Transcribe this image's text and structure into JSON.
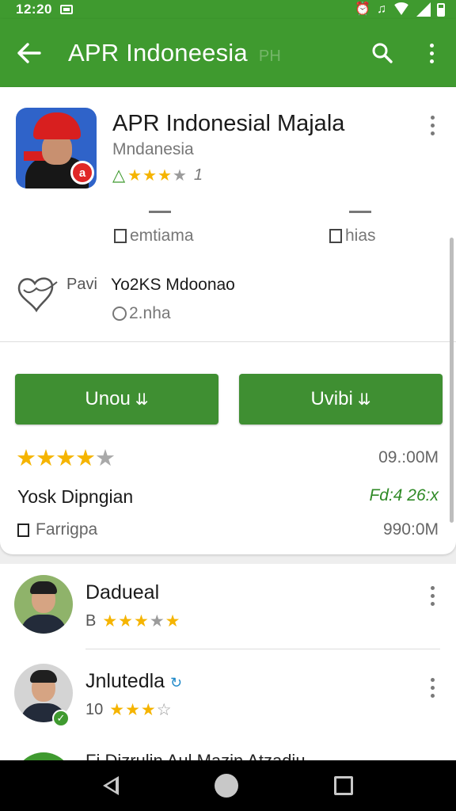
{
  "status_bar": {
    "time": "12:20"
  },
  "app_bar": {
    "title": "APR Indoneesia",
    "ghost_text": "PH"
  },
  "app": {
    "name": "APR Indonesial Majala",
    "developer": "Mndanesia",
    "rating_number": "1",
    "tags": [
      {
        "label": "emtiama"
      },
      {
        "label": "hias"
      }
    ],
    "developer_row": {
      "prefix": "Pavi",
      "title": "Yo2KS Mdoonao",
      "subtitle": "2.nha"
    }
  },
  "buttons": [
    {
      "label": "Unou"
    },
    {
      "label": "Uvibi"
    }
  ],
  "stats": {
    "size_top": "09.:00M",
    "install_label": "Yosk Dipngian",
    "install_count": "Fd:4 26:x",
    "family_label": "Farrigpa",
    "size_bottom": "990:0M"
  },
  "reviews": [
    {
      "name": "Dadueal",
      "star_prefix": "B"
    },
    {
      "name": "Jnlutedla",
      "star_prefix": "10"
    }
  ],
  "partial_row": {
    "text": "Fi Dizrulin Aul Mazin Atzadiu"
  },
  "colors": {
    "brand_green": "#3f9a2f",
    "star": "#f5b400"
  }
}
